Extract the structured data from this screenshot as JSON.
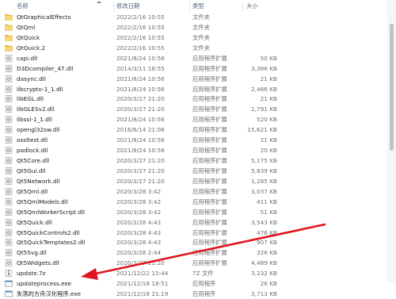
{
  "columns": {
    "name": "名称",
    "date": "修改日期",
    "type": "类型",
    "size": "大小"
  },
  "files": [
    {
      "name": "QtGraphicalEffects",
      "date": "2022/2/16 10:55",
      "type": "文件夹",
      "size": "",
      "icon": "folder-icon"
    },
    {
      "name": "QtQml",
      "date": "2022/2/16 10:55",
      "type": "文件夹",
      "size": "",
      "icon": "folder-icon"
    },
    {
      "name": "QtQuick",
      "date": "2022/2/16 10:55",
      "type": "文件夹",
      "size": "",
      "icon": "folder-icon"
    },
    {
      "name": "QtQuick.2",
      "date": "2022/2/16 10:55",
      "type": "文件夹",
      "size": "",
      "icon": "folder-icon"
    },
    {
      "name": "capi.dll",
      "date": "2021/8/24 10:56",
      "type": "应用程序扩展",
      "size": "50 KB",
      "icon": "dll-icon"
    },
    {
      "name": "D3Dcompiler_47.dll",
      "date": "2014/3/11 18:55",
      "type": "应用程序扩展",
      "size": "3,386 KB",
      "icon": "dll-icon"
    },
    {
      "name": "dasync.dll",
      "date": "2021/8/24 10:56",
      "type": "应用程序扩展",
      "size": "21 KB",
      "icon": "dll-icon"
    },
    {
      "name": "libcrypto-1_1.dll",
      "date": "2021/8/24 10:56",
      "type": "应用程序扩展",
      "size": "2,466 KB",
      "icon": "dll-icon"
    },
    {
      "name": "libEGL.dll",
      "date": "2020/3/27 21:20",
      "type": "应用程序扩展",
      "size": "21 KB",
      "icon": "dll-icon"
    },
    {
      "name": "libGLESv2.dll",
      "date": "2020/3/27 21:20",
      "type": "应用程序扩展",
      "size": "2,791 KB",
      "icon": "dll-icon"
    },
    {
      "name": "libssl-1_1.dll",
      "date": "2021/8/24 10:56",
      "type": "应用程序扩展",
      "size": "520 KB",
      "icon": "dll-icon"
    },
    {
      "name": "opengl32sw.dll",
      "date": "2016/6/14 21:08",
      "type": "应用程序扩展",
      "size": "15,621 KB",
      "icon": "dll-icon"
    },
    {
      "name": "ossltest.dll",
      "date": "2021/8/24 10:56",
      "type": "应用程序扩展",
      "size": "21 KB",
      "icon": "dll-icon"
    },
    {
      "name": "padlock.dll",
      "date": "2021/8/24 10:56",
      "type": "应用程序扩展",
      "size": "20 KB",
      "icon": "dll-icon"
    },
    {
      "name": "Qt5Core.dll",
      "date": "2020/3/27 21:20",
      "type": "应用程序扩展",
      "size": "5,175 KB",
      "icon": "dll-icon"
    },
    {
      "name": "Qt5Gui.dll",
      "date": "2020/3/27 21:20",
      "type": "应用程序扩展",
      "size": "5,839 KB",
      "icon": "dll-icon"
    },
    {
      "name": "Qt5Network.dll",
      "date": "2020/3/27 21:20",
      "type": "应用程序扩展",
      "size": "1,285 KB",
      "icon": "dll-icon"
    },
    {
      "name": "Qt5Qml.dll",
      "date": "2020/3/28 3:42",
      "type": "应用程序扩展",
      "size": "3,037 KB",
      "icon": "dll-icon"
    },
    {
      "name": "Qt5QmlModels.dll",
      "date": "2020/3/28 3:42",
      "type": "应用程序扩展",
      "size": "411 KB",
      "icon": "dll-icon"
    },
    {
      "name": "Qt5QmlWorkerScript.dll",
      "date": "2020/3/28 3:42",
      "type": "应用程序扩展",
      "size": "51 KB",
      "icon": "dll-icon"
    },
    {
      "name": "Qt5Quick.dll",
      "date": "2020/3/28 4:43",
      "type": "应用程序扩展",
      "size": "3,543 KB",
      "icon": "dll-icon"
    },
    {
      "name": "Qt5QuickControls2.dll",
      "date": "2020/3/28 4:43",
      "type": "应用程序扩展",
      "size": "476 KB",
      "icon": "dll-icon"
    },
    {
      "name": "Qt5QuickTemplates2.dll",
      "date": "2020/3/28 4:43",
      "type": "应用程序扩展",
      "size": "907 KB",
      "icon": "dll-icon"
    },
    {
      "name": "Qt5Svg.dll",
      "date": "2020/3/28 2:44",
      "type": "应用程序扩展",
      "size": "326 KB",
      "icon": "dll-icon"
    },
    {
      "name": "Qt5Widgets.dll",
      "date": "2020/3/27 21:20",
      "type": "应用程序扩展",
      "size": "4,489 KB",
      "icon": "dll-icon"
    },
    {
      "name": "update.7z",
      "date": "2021/12/22 15:44",
      "type": "7Z 文件",
      "size": "3,232 KB",
      "icon": "archive-icon"
    },
    {
      "name": "updateprocess.exe",
      "date": "2021/12/18 18:51",
      "type": "应用程序",
      "size": "26 KB",
      "icon": "exe-icon"
    },
    {
      "name": "失落的方舟汉化程序.exe",
      "date": "2021/12/18 21:19",
      "type": "应用程序",
      "size": "3,713 KB",
      "icon": "exe-icon"
    }
  ],
  "colors": {
    "folder": "#f3c652",
    "annotation_arrow": "#e0161e",
    "header_text": "#4c607a"
  }
}
